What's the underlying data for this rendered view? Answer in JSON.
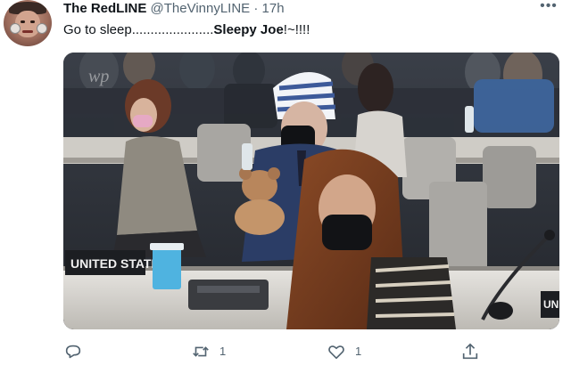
{
  "tweet": {
    "author_name": "The RedLINE",
    "handle": "@TheVinnyLINE",
    "separator": "·",
    "time": "17h",
    "text_before": "Go to sleep......................",
    "text_bold": "Sleepy Joe",
    "text_after": "!~!!!!"
  },
  "media": {
    "sign_left": "UNITED STATES",
    "sign_right": "UN",
    "watermark": "wp"
  },
  "actions": {
    "reply_count": "",
    "retweet_count": "1",
    "like_count": "1",
    "share_count": ""
  },
  "icons": [
    "reply-icon",
    "retweet-icon",
    "like-icon",
    "share-icon",
    "more-icon"
  ],
  "colors": {
    "text": "#0f1419",
    "secondary": "#536471"
  }
}
